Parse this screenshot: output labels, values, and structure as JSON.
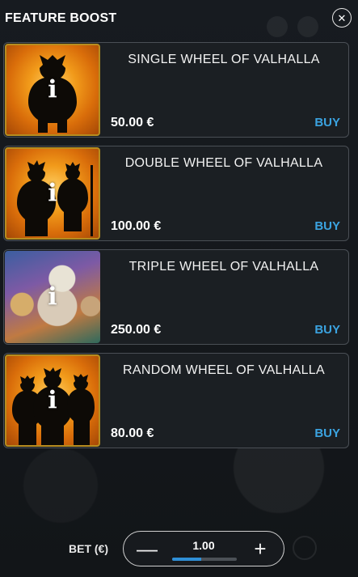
{
  "header": {
    "title": "FEATURE BOOST",
    "close_icon": "✕"
  },
  "items": [
    {
      "name": "SINGLE WHEEL OF VALHALLA",
      "price": "50.00 €",
      "buy_label": "BUY",
      "thumb_style": "sunburst",
      "figures": 1
    },
    {
      "name": "DOUBLE WHEEL OF VALHALLA",
      "price": "100.00 €",
      "buy_label": "BUY",
      "thumb_style": "sunburst",
      "figures": 2
    },
    {
      "name": "TRIPLE WHEEL OF VALHALLA",
      "price": "250.00 €",
      "buy_label": "BUY",
      "thumb_style": "art",
      "figures": 0
    },
    {
      "name": "RANDOM WHEEL OF VALHALLA",
      "price": "80.00 €",
      "buy_label": "BUY",
      "thumb_style": "sunburst",
      "figures": 3
    }
  ],
  "info_glyph": "i",
  "bet": {
    "label": "BET (€)",
    "value": "1.00",
    "minus_symbol": "—",
    "plus_symbol": "+",
    "slider_fraction": 0.45
  },
  "colors": {
    "buy": "#3ba3e0",
    "slider_fill": "#2f8fd6",
    "thumb_border": "#b78d1f"
  }
}
